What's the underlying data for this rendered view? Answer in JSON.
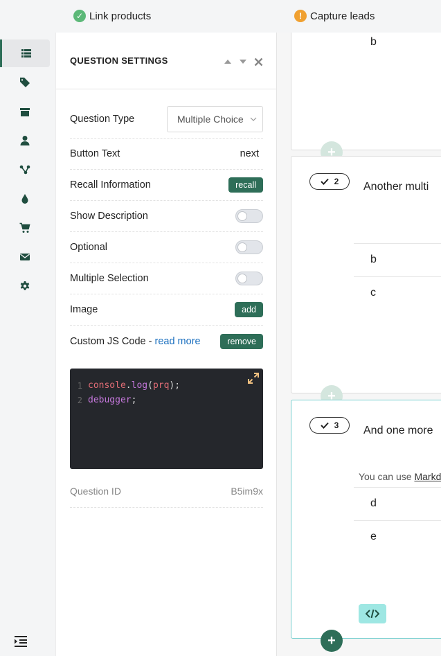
{
  "topbar": {
    "items": [
      {
        "label": "Link products",
        "status": "ok"
      },
      {
        "label": "Capture leads",
        "status": "warning"
      }
    ]
  },
  "sidebar": {
    "items": [
      {
        "icon": "list-icon",
        "active": true
      },
      {
        "icon": "tag-icon",
        "active": false
      },
      {
        "icon": "box-icon",
        "active": false
      },
      {
        "icon": "user-icon",
        "active": false
      },
      {
        "icon": "flow-icon",
        "active": false
      },
      {
        "icon": "drop-icon",
        "active": false
      },
      {
        "icon": "cart-icon",
        "active": false
      },
      {
        "icon": "mail-icon",
        "active": false
      },
      {
        "icon": "gear-icon",
        "active": false
      }
    ]
  },
  "panel": {
    "title": "QUESTION SETTINGS",
    "question_type_label": "Question Type",
    "question_type_value": "Multiple Choice",
    "button_text_label": "Button Text",
    "button_text_value": "next",
    "recall_label": "Recall Information",
    "recall_button": "recall",
    "show_description_label": "Show Description",
    "optional_label": "Optional",
    "multiple_selection_label": "Multiple Selection",
    "image_label": "Image",
    "image_button": "add",
    "custom_js_label": "Custom JS Code - ",
    "custom_js_link": "read more",
    "custom_js_button": "remove",
    "code": {
      "line1_num": "1",
      "line1_fn": "console",
      "line1_dot": ".",
      "line1_method": "log",
      "line1_open": "(",
      "line1_arg": "prq",
      "line1_close": ");",
      "line2_num": "2",
      "line2_kw": "debugger",
      "line2_end": ";"
    },
    "question_id_label": "Question ID",
    "question_id_value": "B5im9x"
  },
  "canvas": {
    "card1": {
      "option_b": "b"
    },
    "card2": {
      "number": "2",
      "title": "Another multi",
      "option_b": "b",
      "option_c": "c"
    },
    "card3": {
      "number": "3",
      "title": "And one more",
      "hint_prefix": "You can use ",
      "hint_link": "Markd",
      "option_d": "d",
      "option_e": "e"
    }
  },
  "colors": {
    "accent": "#2e6e58",
    "active_card_border": "#76cfcf",
    "link": "#1a6fbf"
  }
}
